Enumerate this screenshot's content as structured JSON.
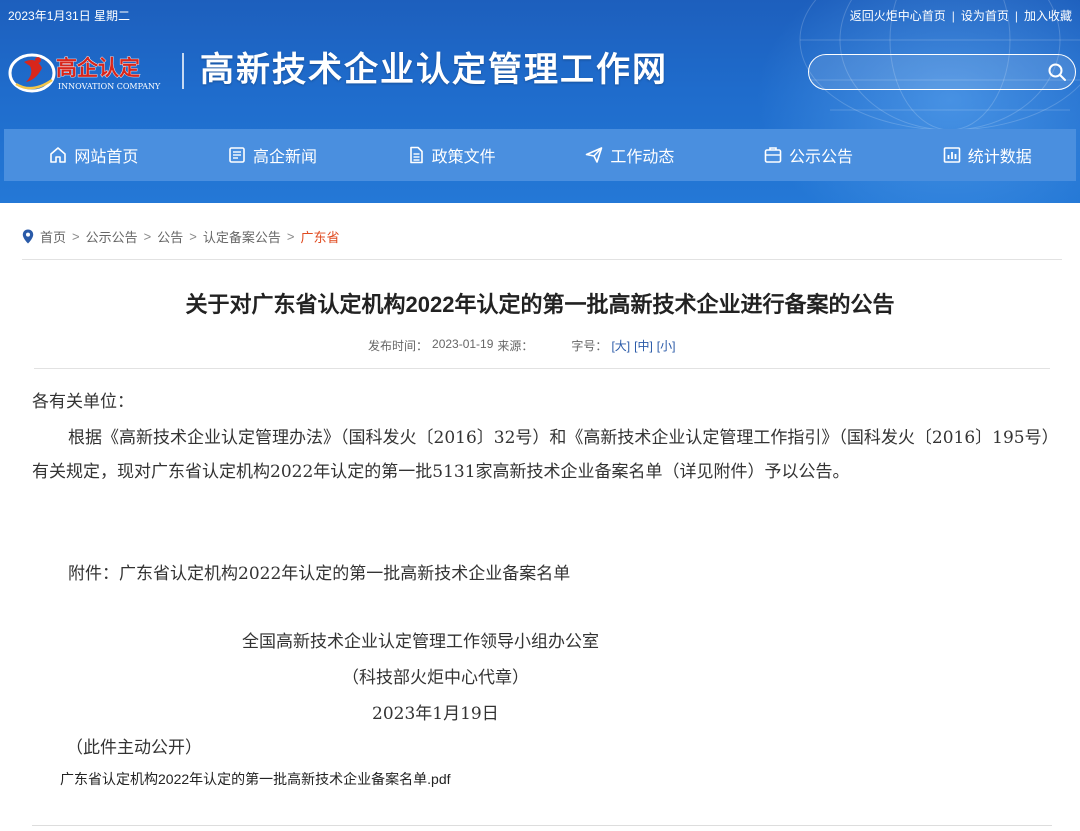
{
  "header": {
    "date": "2023年1月31日 星期二",
    "links": [
      "返回火炬中心首页",
      "设为首页",
      "加入收藏"
    ],
    "logo_text": "高企认定",
    "logo_sub": "INNOVATION COMPANY",
    "site_title": "高新技术企业认定管理工作网",
    "search_placeholder": ""
  },
  "nav": [
    {
      "label": "网站首页",
      "icon": "home-icon"
    },
    {
      "label": "高企新闻",
      "icon": "news-icon"
    },
    {
      "label": "政策文件",
      "icon": "document-icon"
    },
    {
      "label": "工作动态",
      "icon": "send-icon"
    },
    {
      "label": "公示公告",
      "icon": "notice-icon"
    },
    {
      "label": "统计数据",
      "icon": "chart-icon"
    }
  ],
  "breadcrumb": {
    "items": [
      "首页",
      "公示公告",
      "公告",
      "认定备案公告",
      "广东省"
    ],
    "separator": ">"
  },
  "article": {
    "title": "关于对广东省认定机构2022年认定的第一批高新技术企业进行备案的公告",
    "publish_label": "发布时间：",
    "publish_date": "2023-01-19",
    "source_label": "来源：",
    "font_size_label": "字号：",
    "font_sizes": [
      "[大]",
      "[中]",
      "[小]"
    ],
    "greeting": "各有关单位：",
    "main_text": "根据《高新技术企业认定管理办法》（国科发火〔2016〕32号）和《高新技术企业认定管理工作指引》（国科发火〔2016〕195号）有关规定，现对广东省认定机构2022年认定的第一批5131家高新技术企业备案名单（详见附件）予以公告。",
    "attachment_text": "附件：广东省认定机构2022年认定的第一批高新技术企业备案名单",
    "signature_org": "全国高新技术企业认定管理工作领导小组办公室",
    "signature_proxy": "（科技部火炬中心代章）",
    "signature_date": "2023年1月19日",
    "public_note": "（此件主动公开）",
    "file_link": "广东省认定机构2022年认定的第一批高新技术企业备案名单.pdf"
  },
  "colors": {
    "header_blue": "#1f6ccc",
    "nav_blue": "#4a8fdf",
    "breadcrumb_active": "#e04a1f",
    "logo_red": "#d8261c"
  }
}
